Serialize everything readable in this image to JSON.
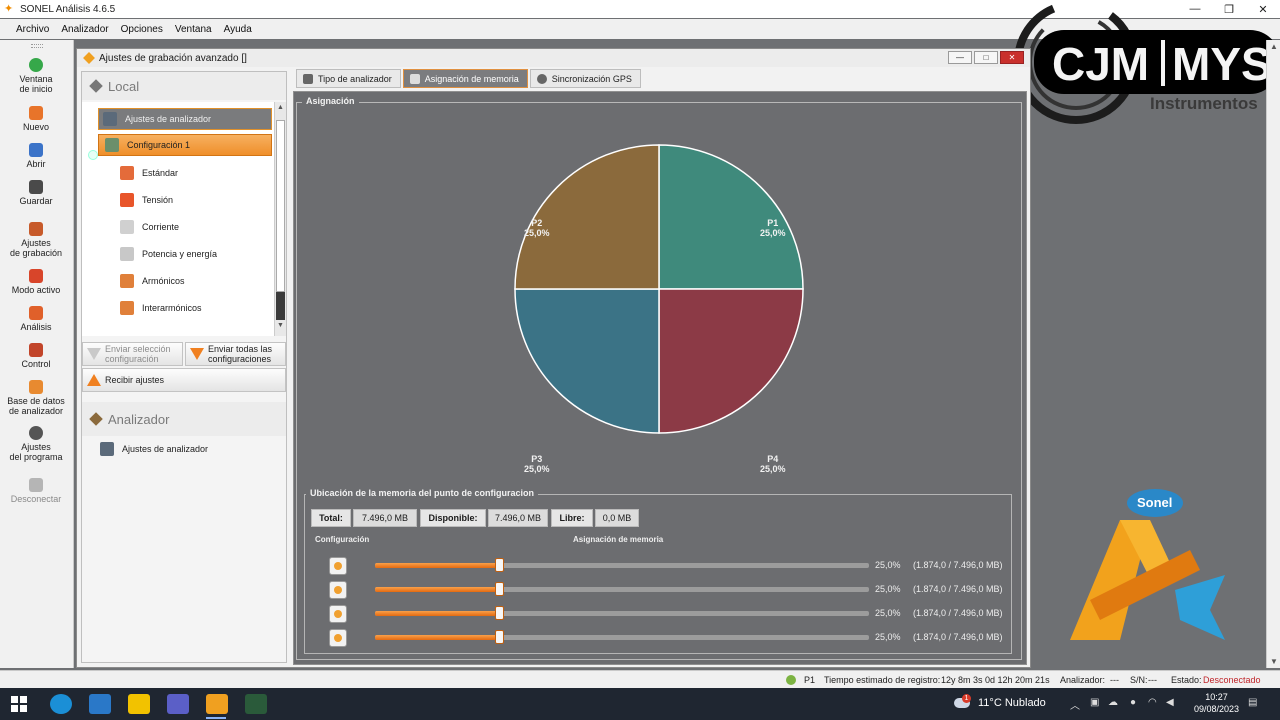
{
  "window": {
    "title": "SONEL Análisis 4.6.5",
    "controls": [
      "—",
      "❐",
      "✕"
    ]
  },
  "menu": [
    "Archivo",
    "Analizador",
    "Opciones",
    "Ventana",
    "Ayuda"
  ],
  "toolbar": {
    "items": [
      {
        "label1": "Ventana",
        "label2": "de inicio",
        "icon": "power-icon",
        "color": "#36a84a"
      },
      {
        "label1": "Nuevo",
        "label2": "",
        "icon": "new-file-icon",
        "color": "#e8742a"
      },
      {
        "label1": "Abrir",
        "label2": "",
        "icon": "open-icon",
        "color": "#3b73c8"
      },
      {
        "label1": "Guardar",
        "label2": "",
        "icon": "save-icon",
        "color": "#4a4a4a"
      },
      {
        "label1": "Ajustes",
        "label2": "de grabación",
        "icon": "recording-settings-icon",
        "color": "#c75a2a"
      },
      {
        "label1": "Modo activo",
        "label2": "",
        "icon": "active-mode-icon",
        "color": "#d8452a"
      },
      {
        "label1": "Análisis",
        "label2": "",
        "icon": "analysis-icon",
        "color": "#e0602a"
      },
      {
        "label1": "Control",
        "label2": "",
        "icon": "control-icon",
        "color": "#c2452a"
      },
      {
        "label1": "Base de datos",
        "label2": "de analizador",
        "icon": "database-icon",
        "color": "#e88a30"
      },
      {
        "label1": "Ajustes",
        "label2": "del programa",
        "icon": "gear-icon",
        "color": "#555555"
      },
      {
        "label1": "Desconectar",
        "label2": "",
        "icon": "disconnect-icon",
        "color": "#b5b5b5"
      }
    ]
  },
  "child_window": {
    "title": "Ajustes de grabación avanzado []"
  },
  "left_panel": {
    "local_header": "Local",
    "tree": {
      "analyzer_settings": "Ajustes de analizador",
      "configuration": "Configuración 1",
      "children": [
        "Estándar",
        "Tensión",
        "Corriente",
        "Potencia y energía",
        "Armónicos",
        "Interarmónicos"
      ]
    },
    "buttons": {
      "send_selection_1": "Enviar selección",
      "send_selection_2": "configuración",
      "send_all_1": "Enviar todas las",
      "send_all_2": "configuraciones",
      "receive": "Recibir ajustes"
    },
    "analyzer_header": "Analizador",
    "analyzer_item": "Ajustes de analizador"
  },
  "tabs": [
    "Tipo de analizador",
    "Asignación de memoria",
    "Sincronización GPS"
  ],
  "assignment": {
    "group_label": "Asignación",
    "slices": [
      {
        "name": "P1",
        "pct": "25,0%",
        "color": "#3f8a7c"
      },
      {
        "name": "P4",
        "pct": "25,0%",
        "color": "#8c3a46"
      },
      {
        "name": "P3",
        "pct": "25,0%",
        "color": "#3b7386"
      },
      {
        "name": "P2",
        "pct": "25,0%",
        "color": "#8b6a3c"
      }
    ]
  },
  "memory": {
    "group_label": "Ubicación de la memoria del punto de configuracion",
    "total_label": "Total:",
    "total_value": "7.496,0 MB",
    "available_label": "Disponible:",
    "available_value": "7.496,0 MB",
    "free_label": "Libre:",
    "free_value": "0,0 MB",
    "col_config": "Configuración",
    "col_assign": "Asignación de memoria",
    "rows": [
      {
        "fraction": 0.25,
        "pct": "25,0%",
        "size": "(1.874,0 / 7.496,0 MB)"
      },
      {
        "fraction": 0.25,
        "pct": "25,0%",
        "size": "(1.874,0 / 7.496,0 MB)"
      },
      {
        "fraction": 0.25,
        "pct": "25,0%",
        "size": "(1.874,0 / 7.496,0 MB)"
      },
      {
        "fraction": 0.25,
        "pct": "25,0%",
        "size": "(1.874,0 / 7.496,0 MB)"
      }
    ]
  },
  "branding": {
    "cjm_text": "CJM",
    "mys_text": "MYS",
    "instrumentos": "Instrumentos",
    "sonel": "Sonel"
  },
  "statusbar": {
    "point": "P1",
    "estimated_label": "Tiempo estimado de registro:",
    "estimated_value": "12y 8m 3s 0d 12h 20m 21s",
    "analyzer_label": "Analizador:",
    "analyzer_value": "---",
    "sn_label": "S/N:",
    "sn_value": "---",
    "state_label": "Estado:",
    "state_value": "Desconectado"
  },
  "taskbar": {
    "weather": "11°C  Nublado",
    "weather_badge": "1",
    "time": "10:27",
    "date": "09/08/2023"
  }
}
